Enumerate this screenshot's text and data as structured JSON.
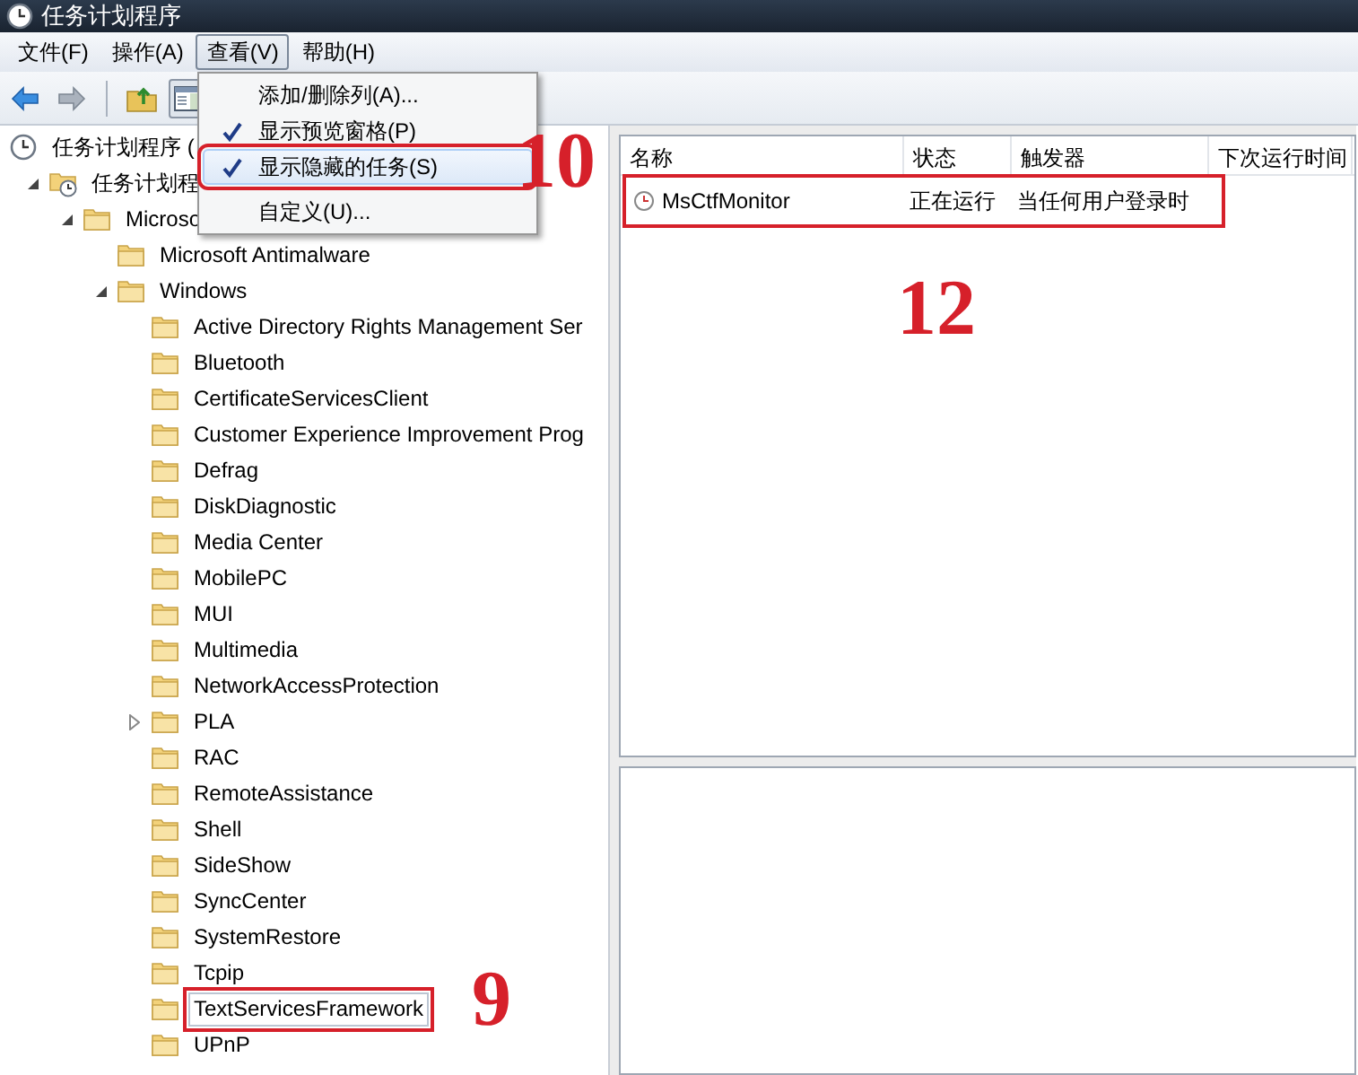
{
  "window": {
    "title": "任务计划程序"
  },
  "menu_bar": [
    {
      "label": "文件(F)",
      "selected": false
    },
    {
      "label": "操作(A)",
      "selected": false
    },
    {
      "label": "查看(V)",
      "selected": true
    },
    {
      "label": "帮助(H)",
      "selected": false
    }
  ],
  "toolbar": [
    {
      "kind": "back",
      "pressed": false
    },
    {
      "kind": "forward",
      "pressed": false
    },
    {
      "kind": "separator"
    },
    {
      "kind": "up",
      "pressed": false
    },
    {
      "kind": "pane",
      "pressed": true
    }
  ],
  "tree": [
    {
      "label": "任务计划程序 (",
      "kind": "clock",
      "children": [
        {
          "label": "任务计划程",
          "kind": "library",
          "expanded": true,
          "children": [
            {
              "label": "Microso",
              "kind": "folder",
              "expanded": true,
              "children": [
                {
                  "label": "Microsoft Antimalware",
                  "kind": "folder"
                },
                {
                  "label": "Windows",
                  "kind": "folder",
                  "expanded": true,
                  "children": [
                    {
                      "label": "Active Directory Rights Management Ser",
                      "kind": "folder"
                    },
                    {
                      "label": "Bluetooth",
                      "kind": "folder"
                    },
                    {
                      "label": "CertificateServicesClient",
                      "kind": "folder"
                    },
                    {
                      "label": "Customer Experience Improvement Prog",
                      "kind": "folder"
                    },
                    {
                      "label": "Defrag",
                      "kind": "folder"
                    },
                    {
                      "label": "DiskDiagnostic",
                      "kind": "folder"
                    },
                    {
                      "label": "Media Center",
                      "kind": "folder"
                    },
                    {
                      "label": "MobilePC",
                      "kind": "folder"
                    },
                    {
                      "label": "MUI",
                      "kind": "folder"
                    },
                    {
                      "label": "Multimedia",
                      "kind": "folder"
                    },
                    {
                      "label": "NetworkAccessProtection",
                      "kind": "folder"
                    },
                    {
                      "label": "PLA",
                      "kind": "folder",
                      "expanded": false
                    },
                    {
                      "label": "RAC",
                      "kind": "folder"
                    },
                    {
                      "label": "RemoteAssistance",
                      "kind": "folder"
                    },
                    {
                      "label": "Shell",
                      "kind": "folder"
                    },
                    {
                      "label": "SideShow",
                      "kind": "folder"
                    },
                    {
                      "label": "SyncCenter",
                      "kind": "folder"
                    },
                    {
                      "label": "SystemRestore",
                      "kind": "folder"
                    },
                    {
                      "label": "Tcpip",
                      "kind": "folder"
                    },
                    {
                      "label": "TextServicesFramework",
                      "kind": "folder",
                      "selected": true,
                      "marked": true
                    },
                    {
                      "label": "UPnP",
                      "kind": "folder"
                    }
                  ]
                }
              ]
            }
          ]
        }
      ]
    }
  ],
  "table": {
    "columns": [
      "名称",
      "状态",
      "触发器",
      "下次运行时间"
    ],
    "rows": [
      {
        "cells": [
          "MsCtfMonitor",
          "正在运行",
          "当任何用户登录时"
        ],
        "marked": true
      }
    ]
  },
  "view_menu": [
    {
      "label": "添加/删除列(A)...",
      "checked": false,
      "selected": false,
      "marked": false
    },
    {
      "label": "显示预览窗格(P)",
      "checked": true,
      "selected": false,
      "marked": false
    },
    {
      "label": "显示隐藏的任务(S)",
      "checked": true,
      "selected": true,
      "marked": true
    },
    {
      "kind": "separator"
    },
    {
      "label": "自定义(U)...",
      "checked": false,
      "selected": false,
      "marked": false
    }
  ],
  "annotations": [
    {
      "label": "10"
    },
    {
      "label": "12"
    },
    {
      "label": "9"
    }
  ]
}
